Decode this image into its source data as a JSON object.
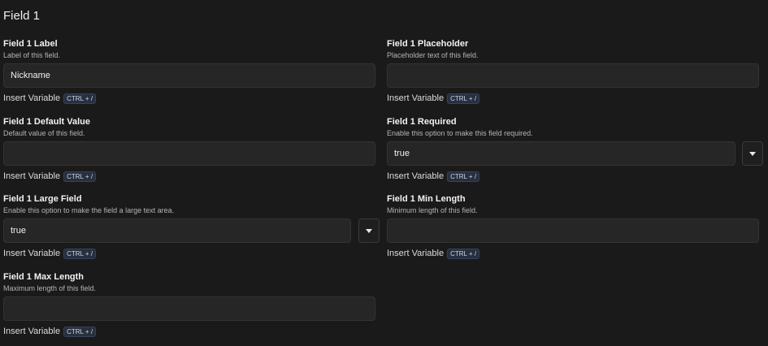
{
  "section_title": "Field 1",
  "insert_variable_label": "Insert Variable",
  "shortcut_label": "CTRL + /",
  "fields": {
    "label": {
      "title": "Field 1 Label",
      "description": "Label of this field.",
      "value": "Nickname",
      "placeholder": ""
    },
    "placeholder": {
      "title": "Field 1 Placeholder",
      "description": "Placeholder text of this field.",
      "value": "",
      "placeholder": ""
    },
    "default_value": {
      "title": "Field 1 Default Value",
      "description": "Default value of this field.",
      "value": "",
      "placeholder": ""
    },
    "required": {
      "title": "Field 1 Required",
      "description": "Enable this option to make this field required.",
      "value": "true"
    },
    "large_field": {
      "title": "Field 1 Large Field",
      "description": "Enable this option to make the field a large text area.",
      "value": "true"
    },
    "min_length": {
      "title": "Field 1 Min Length",
      "description": "Minimum length of this field.",
      "value": "",
      "placeholder": ""
    },
    "max_length": {
      "title": "Field 1 Max Length",
      "description": "Maximum length of this field.",
      "value": "",
      "placeholder": ""
    }
  },
  "colors": {
    "background": "#1a1a1a",
    "input_background": "#262626",
    "shortcut_badge": "#27303f"
  },
  "icons": {
    "dropdown": "chevron-down-icon"
  }
}
